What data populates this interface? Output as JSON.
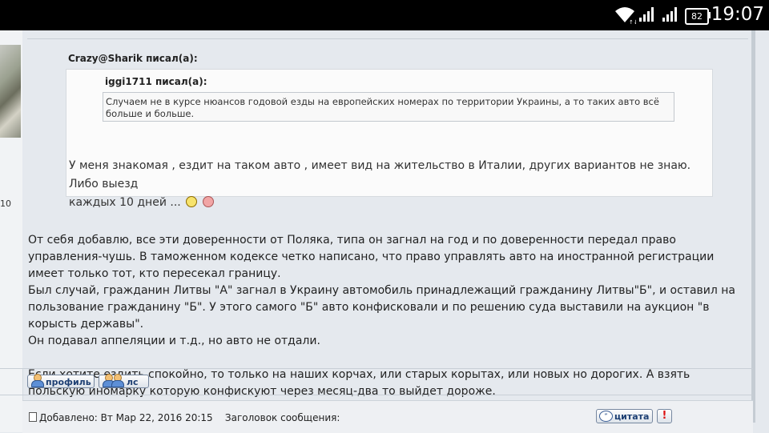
{
  "statusbar": {
    "time": "19:07",
    "battery": "82"
  },
  "left": {
    "post_count_fragment": "10"
  },
  "post": {
    "quote": {
      "author": "Crazy@Sharik писал(а):",
      "inner_author": "iggi1711 писал(а):",
      "inner_text": "Случаем не в курсе нюансов годовой езды на европейских номерах по территории Украины, а то таких авто всё больше и больше.",
      "reply_line1": "У меня знакомая , ездит на таком авто , имеет вид на жительство в Италии, других вариантов не знаю. Либо выезд",
      "reply_line2": "каждых 10 дней ..."
    },
    "body": {
      "p1": "От себя добавлю, все эти доверенности от Поляка, типа он загнал на год и по доверенности передал право управления-чушь. В таможенном кодексе четко написано, что право управлять авто на иностранной регистрации имеет только тот, кто пересекал границу.",
      "p2": "Был случай, гражданин Литвы \"А\" загнал в Украину автомобиль принадлежащий гражданину Литвы\"Б\", и оставил на пользование гражданину \"Б\". У этого самого \"Б\" авто конфисковали и по решению суда выставили на аукцион \"в корысть державы\".",
      "p3": "Он подавал аппеляции и т.д., но авто не отдали.",
      "p4": "Если хотите ездить спокойно, то только на наших корчах, или старых корытах, или новых но дорогих. А взять польскую иномарку которую конфискуют через месяц-два то выйдет дороже."
    },
    "buttons": {
      "profile": "профиль",
      "pm": "лс"
    }
  },
  "next_post": {
    "added": "Добавлено: Вт Мар 22, 2016 20:15",
    "subject": "Заголовок сообщения:",
    "quote_button": "цитата",
    "report_button": "!"
  },
  "icons": [
    "wifi-icon",
    "signal-icon",
    "battery-icon",
    "profile-icon",
    "pm-icon",
    "quote-icon",
    "report-icon",
    "rolleyes-smiley-icon",
    "sad-smiley-icon",
    "document-icon"
  ]
}
